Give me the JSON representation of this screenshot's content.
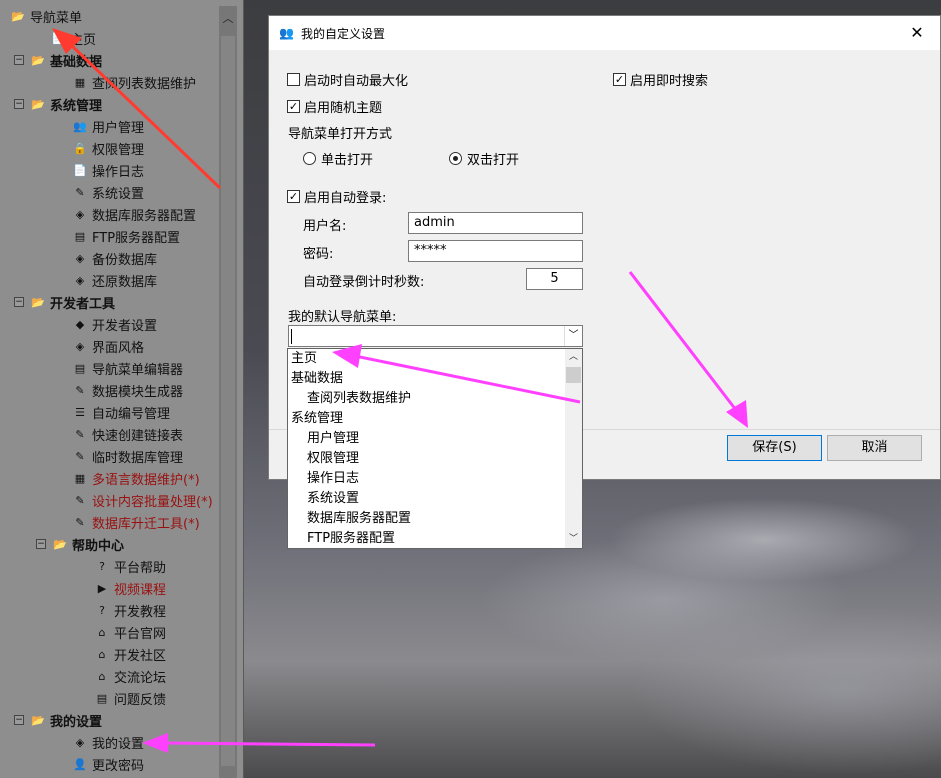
{
  "tree": {
    "nodes": [
      {
        "label": "导航菜单",
        "bold": false,
        "kind": "root"
      },
      {
        "label": "主页",
        "bold": false
      },
      {
        "label": "基础数据",
        "bold": true
      },
      {
        "label": "查阅列表数据维护"
      },
      {
        "label": "系统管理",
        "bold": true
      },
      {
        "label": "用户管理"
      },
      {
        "label": "权限管理"
      },
      {
        "label": "操作日志"
      },
      {
        "label": "系统设置"
      },
      {
        "label": "数据库服务器配置"
      },
      {
        "label": "FTP服务器配置"
      },
      {
        "label": "备份数据库"
      },
      {
        "label": "还原数据库"
      },
      {
        "label": "开发者工具",
        "bold": true
      },
      {
        "label": "开发者设置"
      },
      {
        "label": "界面风格"
      },
      {
        "label": "导航菜单编辑器"
      },
      {
        "label": "数据模块生成器"
      },
      {
        "label": "自动编号管理"
      },
      {
        "label": "快速创建链接表"
      },
      {
        "label": "临时数据库管理"
      },
      {
        "label": "多语言数据维护(*)",
        "red": true
      },
      {
        "label": "设计内容批量处理(*)",
        "red": true
      },
      {
        "label": "数据库升迁工具(*)",
        "red": true
      },
      {
        "label": "帮助中心",
        "bold": true
      },
      {
        "label": "平台帮助"
      },
      {
        "label": "视频课程",
        "red": true
      },
      {
        "label": "开发教程"
      },
      {
        "label": "平台官网"
      },
      {
        "label": "开发社区"
      },
      {
        "label": "交流论坛"
      },
      {
        "label": "问题反馈"
      },
      {
        "label": "我的设置",
        "bold": true
      },
      {
        "label": "我的设置"
      },
      {
        "label": "更改密码"
      }
    ]
  },
  "dialog": {
    "title": "我的自定义设置",
    "close_glyph": "✕",
    "maximize_label": "启动时自动最大化",
    "maximize_checked": false,
    "instant_search_label": "启用即时搜索",
    "instant_search_checked": true,
    "random_theme_label": "启用随机主题",
    "random_theme_checked": true,
    "nav_open_label": "导航菜单打开方式",
    "single_click_label": "单击打开",
    "double_click_label": "双击打开",
    "auto_login_label": "启用自动登录:",
    "auto_login_checked": true,
    "username_label": "用户名:",
    "username_value": "admin",
    "password_label": "密码:",
    "password_value": "*****",
    "countdown_label": "自动登录倒计时秒数:",
    "countdown_value": "5",
    "default_nav_label": "我的默认导航菜单:",
    "save_label": "保存(S)",
    "cancel_label": "取消"
  },
  "dropdown": {
    "items": [
      {
        "label": "主页",
        "indent": 0
      },
      {
        "label": "基础数据",
        "indent": 0
      },
      {
        "label": "查阅列表数据维护",
        "indent": 1
      },
      {
        "label": "系统管理",
        "indent": 0
      },
      {
        "label": "用户管理",
        "indent": 1
      },
      {
        "label": "权限管理",
        "indent": 1
      },
      {
        "label": "操作日志",
        "indent": 1
      },
      {
        "label": "系统设置",
        "indent": 1
      },
      {
        "label": "数据库服务器配置",
        "indent": 1
      },
      {
        "label": "FTP服务器配置",
        "indent": 1
      }
    ]
  },
  "colors": {
    "arrow_red": "#ff3b2f",
    "arrow_magenta": "#ff40ff"
  }
}
